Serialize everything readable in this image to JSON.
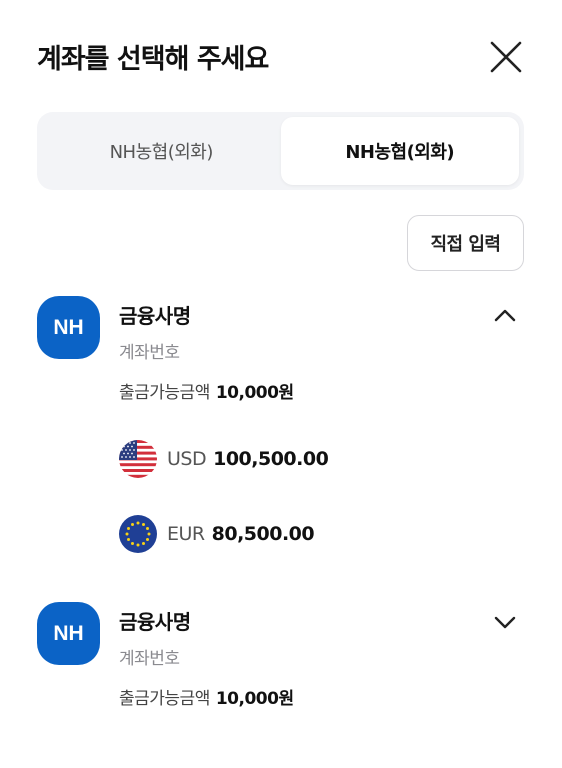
{
  "header": {
    "title": "계좌를 선택해 주세요",
    "close_icon": "close-icon"
  },
  "tabs": [
    {
      "label": "NH농협(외화)",
      "active": false
    },
    {
      "label": "NH농협(외화)",
      "active": true
    }
  ],
  "direct_input_label": "직접 입력",
  "accounts": [
    {
      "logo_text": "NH",
      "name": "금융사명",
      "number": "계좌번호",
      "balance_label": "출금가능금액",
      "balance_amount": "10,000원",
      "expanded": true,
      "toggle_icon": "chevron-up-icon",
      "currencies": [
        {
          "flag_icon": "us-flag-icon",
          "code": "USD",
          "amount": "100,500.00"
        },
        {
          "flag_icon": "eu-flag-icon",
          "code": "EUR",
          "amount": "80,500.00"
        }
      ]
    },
    {
      "logo_text": "NH",
      "name": "금융사명",
      "number": "계좌번호",
      "balance_label": "출금가능금액",
      "balance_amount": "10,000원",
      "expanded": false,
      "toggle_icon": "chevron-down-icon"
    }
  ],
  "colors": {
    "brand": "#0b63c6",
    "segment_bg": "#f3f4f7",
    "muted_text": "#8a8a8f"
  }
}
